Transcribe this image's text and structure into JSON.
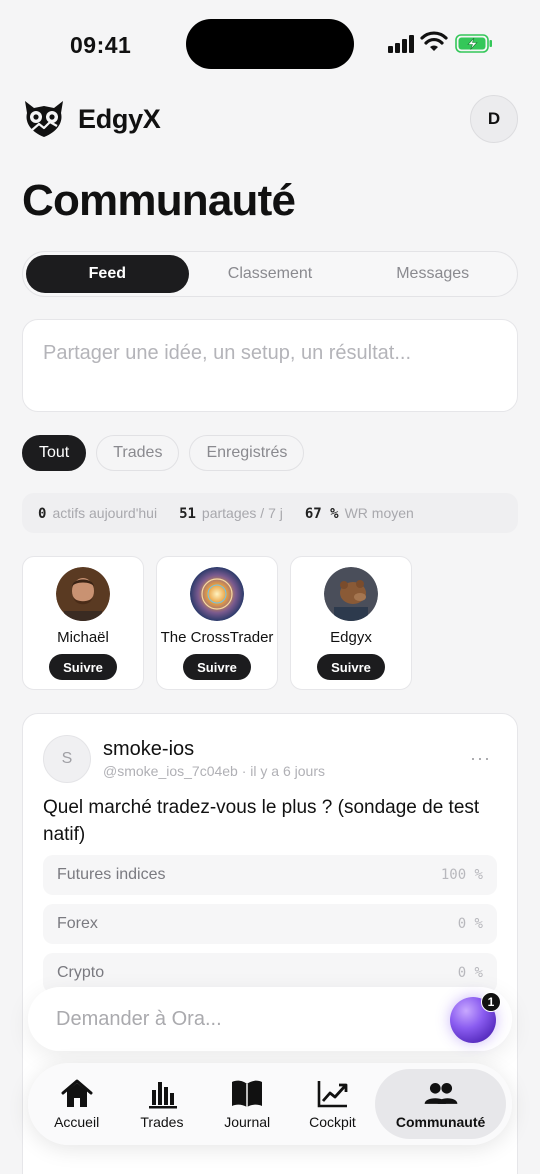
{
  "status_bar": {
    "time": "09:41"
  },
  "header": {
    "brand": "EdgyX",
    "avatar_initial": "D",
    "page_title": "Communauté"
  },
  "tabs": [
    {
      "label": "Feed",
      "active": true
    },
    {
      "label": "Classement",
      "active": false
    },
    {
      "label": "Messages",
      "active": false
    }
  ],
  "composer": {
    "placeholder": "Partager une idée, un setup, un résultat..."
  },
  "filters": [
    {
      "label": "Tout",
      "active": true
    },
    {
      "label": "Trades",
      "active": false
    },
    {
      "label": "Enregistrés",
      "active": false
    }
  ],
  "stats": [
    {
      "value": "0",
      "label": "actifs aujourd'hui"
    },
    {
      "value": "51",
      "label": "partages / 7 j"
    },
    {
      "value": "67 %",
      "label": "WR moyen"
    }
  ],
  "traders": [
    {
      "name": "Michaël",
      "follow_label": "Suivre"
    },
    {
      "name": "The CrossTrader",
      "follow_label": "Suivre"
    },
    {
      "name": "Edgyx",
      "follow_label": "Suivre"
    }
  ],
  "post": {
    "avatar_initial": "S",
    "username": "smoke-ios",
    "meta": "@smoke_ios_7c04eb · il y a 6 jours",
    "more": "···",
    "question": "Quel marché tradez-vous le plus ? (sondage de test natif)",
    "options": [
      {
        "label": "Futures indices",
        "pct": "100 %"
      },
      {
        "label": "Forex",
        "pct": "0 %"
      },
      {
        "label": "Crypto",
        "pct": "0 %"
      }
    ]
  },
  "ora": {
    "placeholder": "Demander à Ora...",
    "badge": "1"
  },
  "tabbar": [
    {
      "label": "Accueil",
      "icon": "home-icon"
    },
    {
      "label": "Trades",
      "icon": "bar-chart-icon"
    },
    {
      "label": "Journal",
      "icon": "book-icon"
    },
    {
      "label": "Cockpit",
      "icon": "trend-icon"
    },
    {
      "label": "Communauté",
      "icon": "users-icon",
      "active": true
    }
  ],
  "colors": {
    "accent": "#1c1c1e",
    "background": "#f5f5f6",
    "ora_orb": "#8a5cf0",
    "battery": "#34c759"
  }
}
